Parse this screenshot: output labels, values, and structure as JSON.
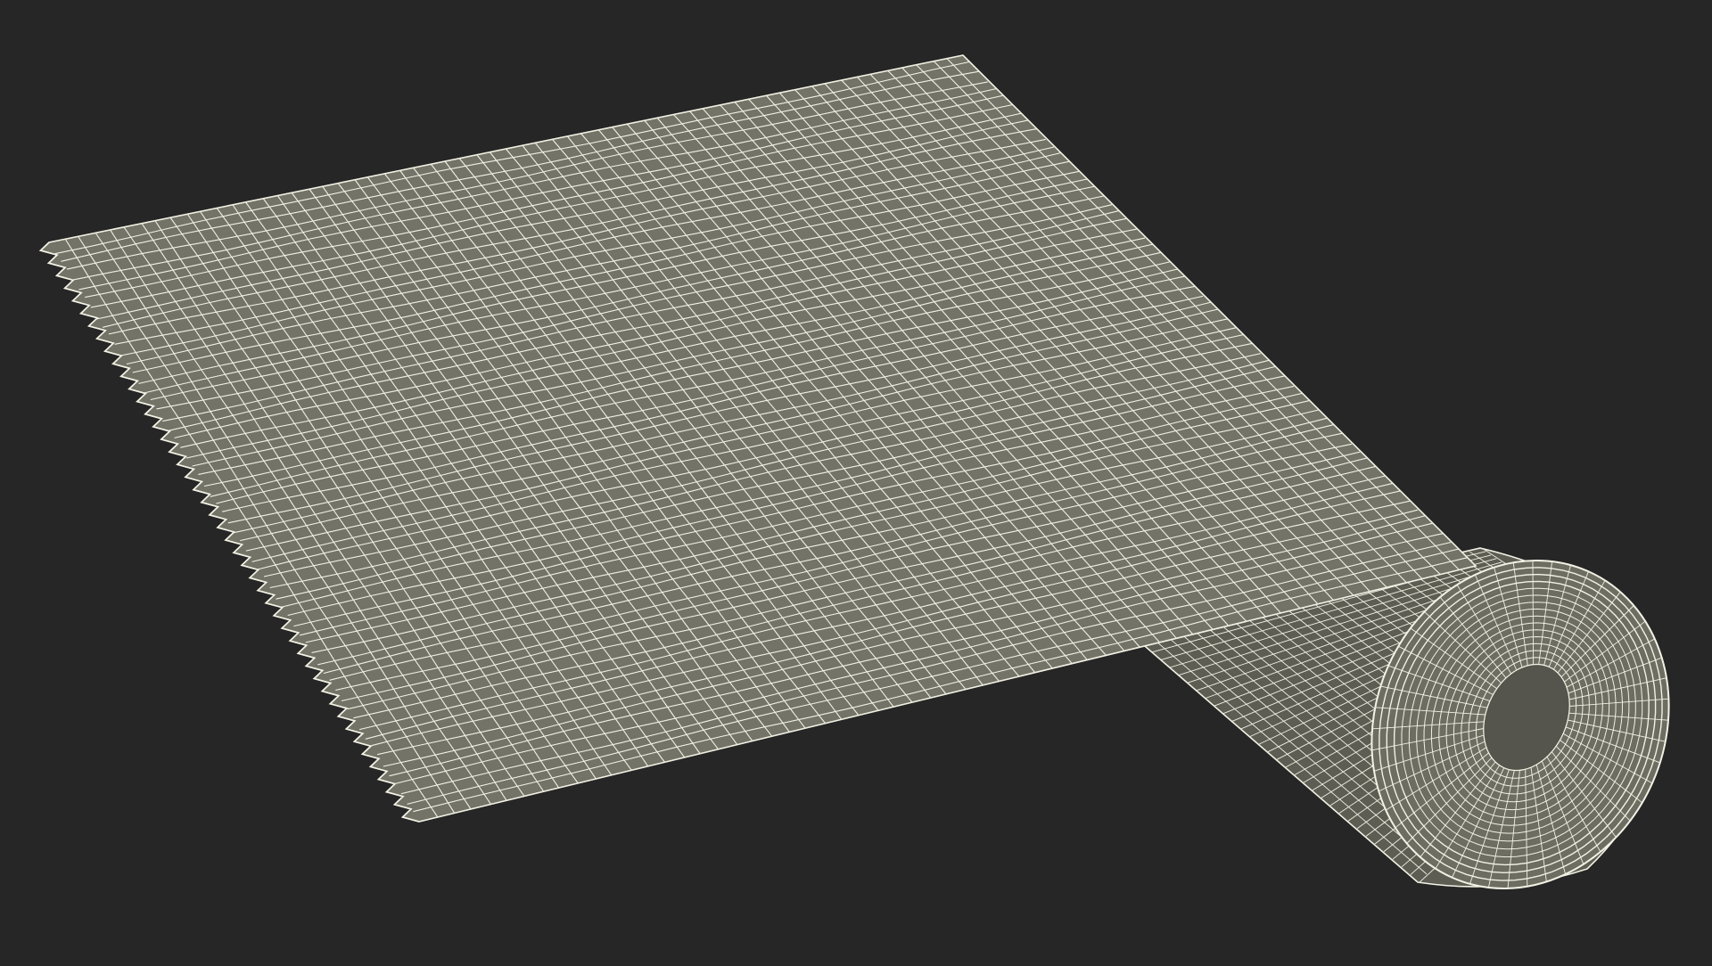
{
  "scene": {
    "subject": "paper-towel-roll-wireframe",
    "background_color": "#262626",
    "surface_color": "#737367",
    "surface_shadow_color": "#5d5d54",
    "wire_color": "#f2f1e4"
  }
}
